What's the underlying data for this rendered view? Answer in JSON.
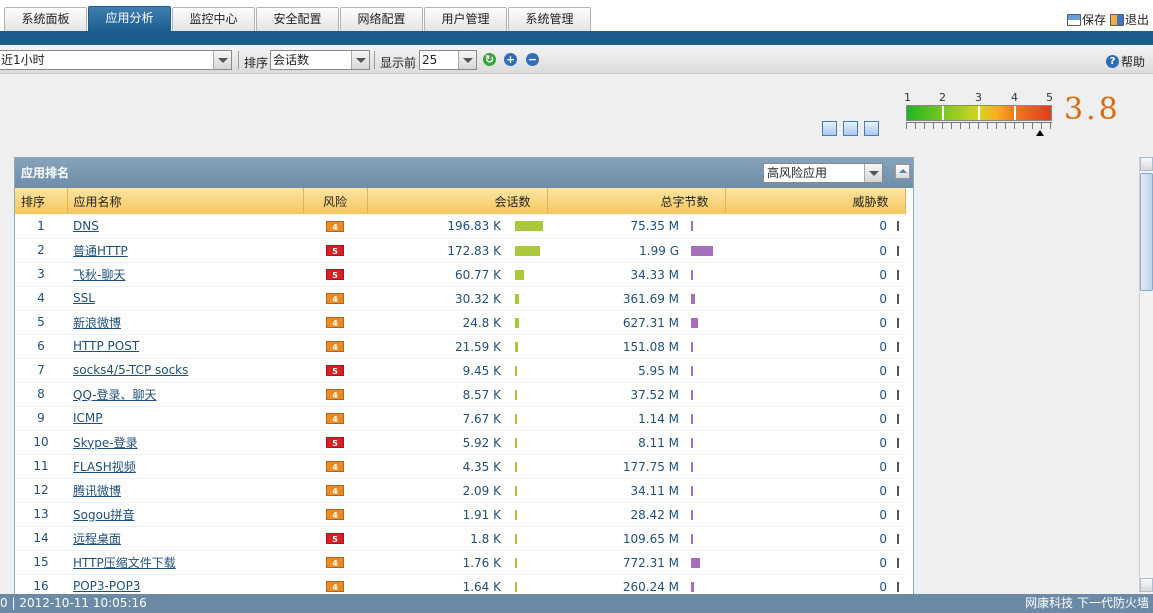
{
  "tabs": [
    "系统面板",
    "应用分析",
    "监控中心",
    "安全配置",
    "网络配置",
    "用户管理",
    "系统管理"
  ],
  "top_actions": {
    "save": "保存",
    "exit": "退出"
  },
  "toolbar": {
    "time_range": "近1小时",
    "sort_label": "排序",
    "sort_value": "会话数",
    "top_label": "显示前",
    "top_value": "25",
    "help": "帮助"
  },
  "gauge": {
    "ticks": [
      "1",
      "2",
      "3",
      "4",
      "5"
    ],
    "score": "3.8",
    "score_value": 3.8
  },
  "panel": {
    "title": "应用排名",
    "filter": "高风险应用",
    "columns": [
      "排序",
      "应用名称",
      "风险",
      "会话数",
      "总字节数",
      "威胁数"
    ]
  },
  "rows": [
    {
      "rank": "1",
      "app": "DNS",
      "risk": "4",
      "sessions": "196.83 K",
      "bytes": "75.35 M",
      "threats": "0"
    },
    {
      "rank": "2",
      "app": "普通HTTP",
      "risk": "5",
      "sessions": "172.83 K",
      "bytes": "1.99 G",
      "threats": "0"
    },
    {
      "rank": "3",
      "app": "飞秋-聊天",
      "risk": "5",
      "sessions": "60.77 K",
      "bytes": "34.33 M",
      "threats": "0"
    },
    {
      "rank": "4",
      "app": "SSL",
      "risk": "4",
      "sessions": "30.32 K",
      "bytes": "361.69 M",
      "threats": "0"
    },
    {
      "rank": "5",
      "app": "新浪微博",
      "risk": "4",
      "sessions": "24.8 K",
      "bytes": "627.31 M",
      "threats": "0"
    },
    {
      "rank": "6",
      "app": "HTTP POST",
      "risk": "4",
      "sessions": "21.59 K",
      "bytes": "151.08 M",
      "threats": "0"
    },
    {
      "rank": "7",
      "app": "socks4/5-TCP socks",
      "risk": "5",
      "sessions": "9.45 K",
      "bytes": "5.95 M",
      "threats": "0"
    },
    {
      "rank": "8",
      "app": "QQ-登录、聊天",
      "risk": "4",
      "sessions": "8.57 K",
      "bytes": "37.52 M",
      "threats": "0"
    },
    {
      "rank": "9",
      "app": "ICMP",
      "risk": "4",
      "sessions": "7.67 K",
      "bytes": "1.14 M",
      "threats": "0"
    },
    {
      "rank": "10",
      "app": "Skype-登录",
      "risk": "5",
      "sessions": "5.92 K",
      "bytes": "8.11 M",
      "threats": "0"
    },
    {
      "rank": "11",
      "app": "FLASH视频",
      "risk": "4",
      "sessions": "4.35 K",
      "bytes": "177.75 M",
      "threats": "0"
    },
    {
      "rank": "12",
      "app": "腾讯微博",
      "risk": "4",
      "sessions": "2.09 K",
      "bytes": "34.11 M",
      "threats": "0"
    },
    {
      "rank": "13",
      "app": "Sogou拼音",
      "risk": "4",
      "sessions": "1.91 K",
      "bytes": "28.42 M",
      "threats": "0"
    },
    {
      "rank": "14",
      "app": "远程桌面",
      "risk": "5",
      "sessions": "1.8 K",
      "bytes": "109.65 M",
      "threats": "0"
    },
    {
      "rank": "15",
      "app": "HTTP压缩文件下载",
      "risk": "4",
      "sessions": "1.76 K",
      "bytes": "772.31 M",
      "threats": "0"
    },
    {
      "rank": "16",
      "app": "POP3-POP3",
      "risk": "4",
      "sessions": "1.64 K",
      "bytes": "260.24 M",
      "threats": "0"
    }
  ],
  "colors": {
    "risk5": "#d81f26",
    "risk4": "#ef8a24",
    "session_bar": "#a9c93a",
    "bytes_bar": "#a56fbb",
    "accent": "#1a5d8e"
  },
  "status": {
    "left": "0 | 2012-10-11 10:05:16",
    "right": "网康科技 下一代防火墙"
  }
}
